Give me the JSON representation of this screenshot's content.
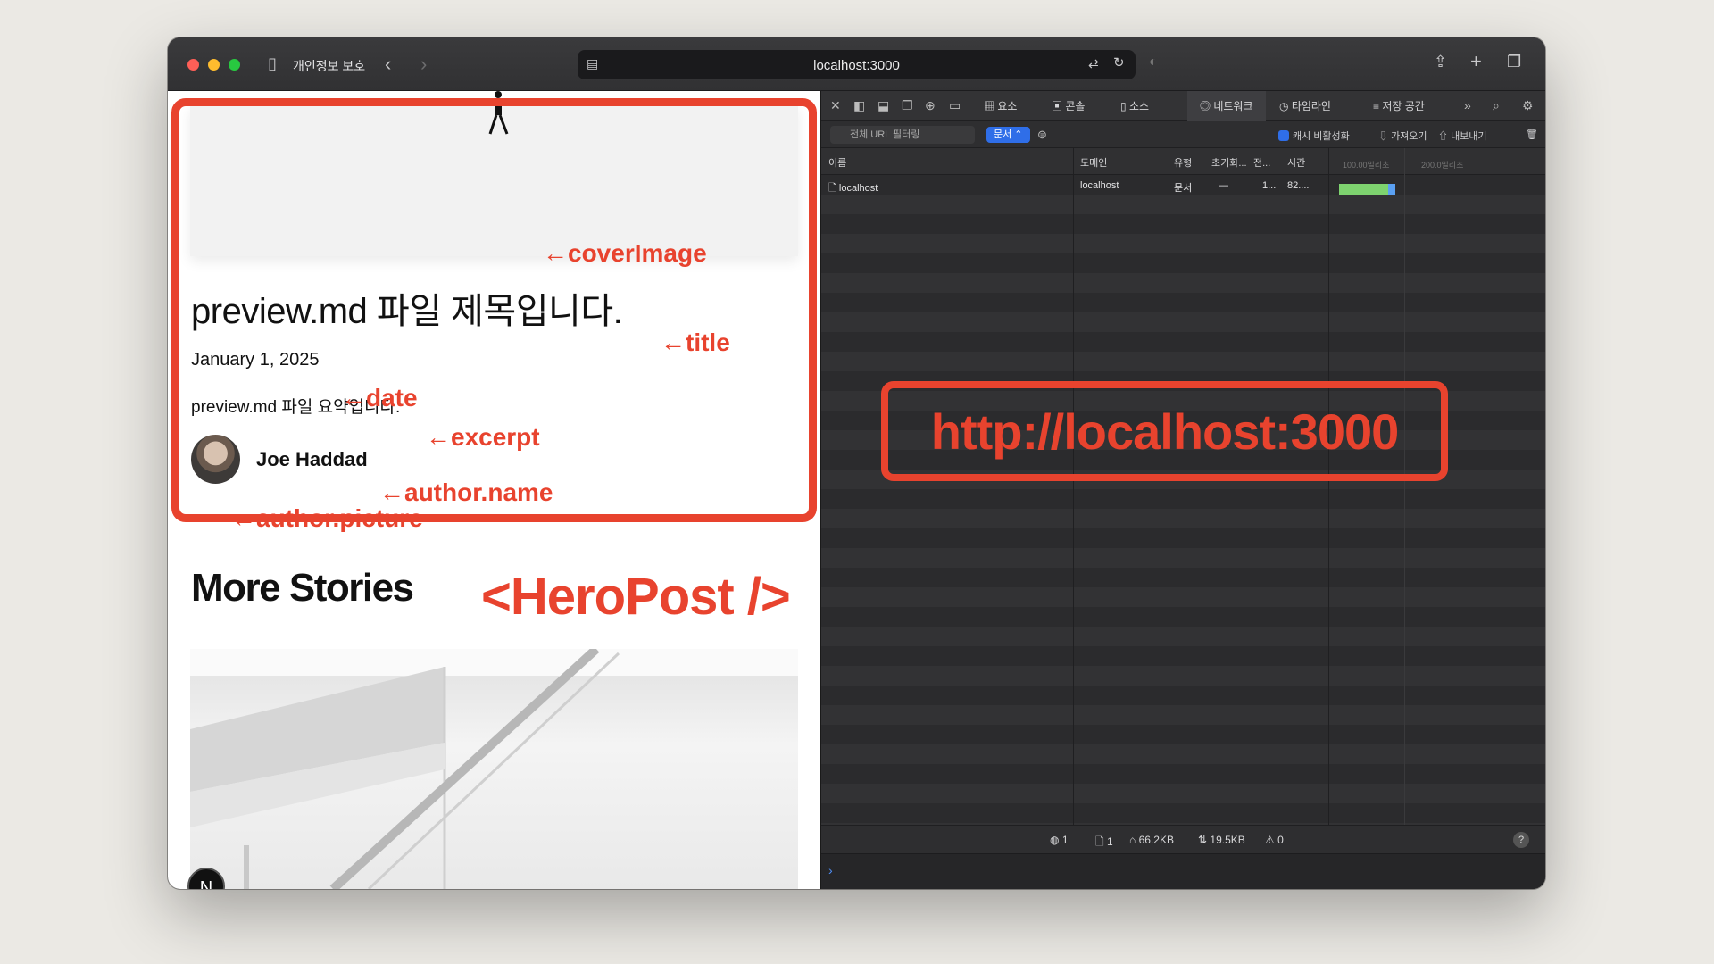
{
  "browser": {
    "privacy_label": "개인정보 보호",
    "url": "localhost:3000"
  },
  "page": {
    "title": "preview.md 파일 제목입니다.",
    "date": "January 1, 2025",
    "excerpt": "preview.md 파일 요약입니다.",
    "author_name": "Joe Haddad",
    "more_stories": "More Stories",
    "next_badge": "N"
  },
  "annotations": {
    "cover_image": "←coverImage",
    "title": "←title",
    "date": "←date",
    "excerpt": "←excerpt",
    "author_name": "←author.name",
    "author_picture": "←author.picture",
    "component": "<HeroPost />",
    "url": "http://localhost:3000",
    "color": "#e8432e"
  },
  "devtools": {
    "tabs": [
      "요소",
      "콘솔",
      "소스",
      "네트워크",
      "타임라인",
      "저장 공간"
    ],
    "active_tab": "네트워크",
    "filter_placeholder": "전체 URL 필터링",
    "type_filter": "문서",
    "disable_cache": "캐시 비활성화",
    "import": "가져오기",
    "export": "내보내기",
    "columns": [
      "이름",
      "도메인",
      "유형",
      "초기화...",
      "전...",
      "시간"
    ],
    "waterfall_ticks": [
      "100.00밀리초",
      "200.0밀리초"
    ],
    "rows": [
      {
        "name": "localhost",
        "domain": "localhost",
        "type": "문서",
        "initiator": "—",
        "transferred": "1...",
        "time": "82...."
      }
    ],
    "status": {
      "requests": "1",
      "resources": "1",
      "resources_size": "66.2KB",
      "transferred": "19.5KB",
      "errors": "0"
    },
    "help": "?",
    "console_prompt": "›"
  }
}
